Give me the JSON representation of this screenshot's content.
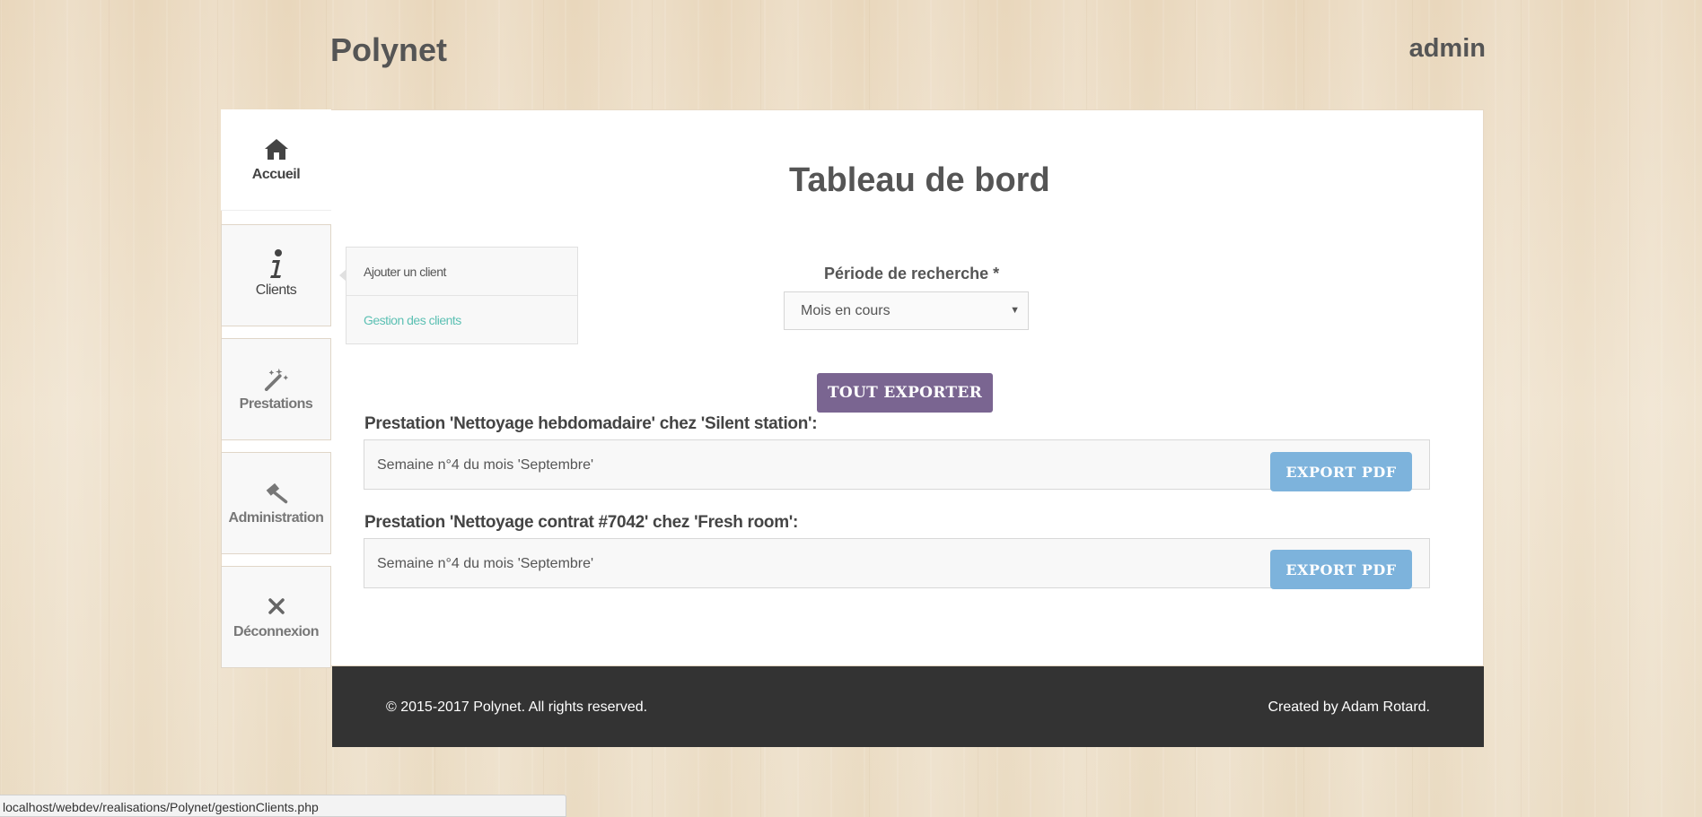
{
  "header": {
    "logo": "Polynet",
    "user": "admin"
  },
  "nav": [
    {
      "label": "Accueil",
      "icon": "home-icon"
    },
    {
      "label": "Clients",
      "icon": "info-icon"
    },
    {
      "label": "Prestations",
      "icon": "magic-wand-icon"
    },
    {
      "label": "Administration",
      "icon": "gavel-icon"
    },
    {
      "label": "Déconnexion",
      "icon": "close-icon"
    }
  ],
  "submenu": {
    "items": [
      {
        "label": "Ajouter un client"
      },
      {
        "label": "Gestion des clients"
      }
    ]
  },
  "main": {
    "title": "Tableau de bord",
    "period_label": "Période de recherche *",
    "period_value": "Mois en cours",
    "export_all_label": "TOUT EXPORTER",
    "prestations": [
      {
        "title": "Prestation 'Nettoyage hebdomadaire' chez 'Silent station':",
        "week": "Semaine n°4 du mois 'Septembre'",
        "export_label": "EXPORT PDF"
      },
      {
        "title": "Prestation 'Nettoyage contrat #7042' chez 'Fresh room':",
        "week": "Semaine n°4 du mois 'Septembre'",
        "export_label": "EXPORT PDF"
      }
    ]
  },
  "footer": {
    "copyright": "© 2015-2017 Polynet. All rights reserved.",
    "credit": "Created by Adam Rotard."
  },
  "status_bar": {
    "url": "localhost/webdev/realisations/Polynet/gestionClients.php"
  },
  "colors": {
    "accent_purple": "#7a6591",
    "button_blue": "#7db3dc",
    "link_teal": "#5cc0b3",
    "footer_bg": "#333333"
  }
}
